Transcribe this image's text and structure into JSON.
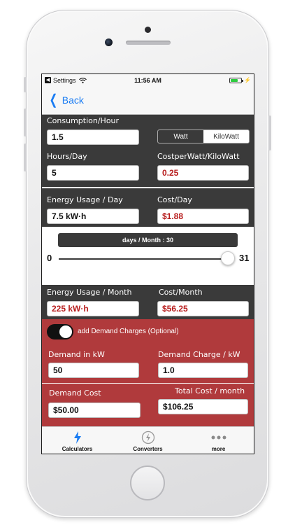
{
  "status_bar": {
    "back_app": "Settings",
    "time": "11:56 AM"
  },
  "nav": {
    "back_label": "Back"
  },
  "consumption": {
    "label": "Consumption/Hour",
    "value": "1.5",
    "unit_options": [
      "Watt",
      "KiloWatt"
    ],
    "selected_unit": "Watt"
  },
  "hours": {
    "label": "Hours/Day",
    "value": "5"
  },
  "cost_per_watt": {
    "label": "CostperWatt/KiloWatt",
    "value": "0.25"
  },
  "energy_day": {
    "label": "Energy Usage / Day",
    "value": "7.5 kW·h"
  },
  "cost_day": {
    "label": "Cost/Day",
    "value": "$1.88"
  },
  "slider": {
    "title": "days / Month : 30",
    "min_label": "0",
    "max_label": "31",
    "value": 30,
    "min": 0,
    "max": 31
  },
  "energy_month": {
    "label": "Energy Usage / Month",
    "value": "225 kW·h"
  },
  "cost_month": {
    "label": "Cost/Month",
    "value": "$56.25"
  },
  "demand": {
    "toggle_label": "add Demand Charges (Optional)",
    "toggle_on": true,
    "kw_label": "Demand in kW",
    "kw_value": "50",
    "charge_label": "Demand Charge / kW",
    "charge_value": "1.0",
    "cost_label": "Demand Cost",
    "cost_value": "$50.00",
    "total_label": "Total Cost / month",
    "total_value": "$106.25"
  },
  "tabs": [
    {
      "label": "Calculators",
      "icon": "bolt-icon",
      "active": true
    },
    {
      "label": "Converters",
      "icon": "gauge-icon",
      "active": false
    },
    {
      "label": "more",
      "icon": "more-dots-icon",
      "active": false
    }
  ],
  "colors": {
    "dark_panel": "#3a3a3a",
    "red_panel": "#b03a3c",
    "accent_blue": "#1a7cf3",
    "value_red": "#b71c1c"
  }
}
